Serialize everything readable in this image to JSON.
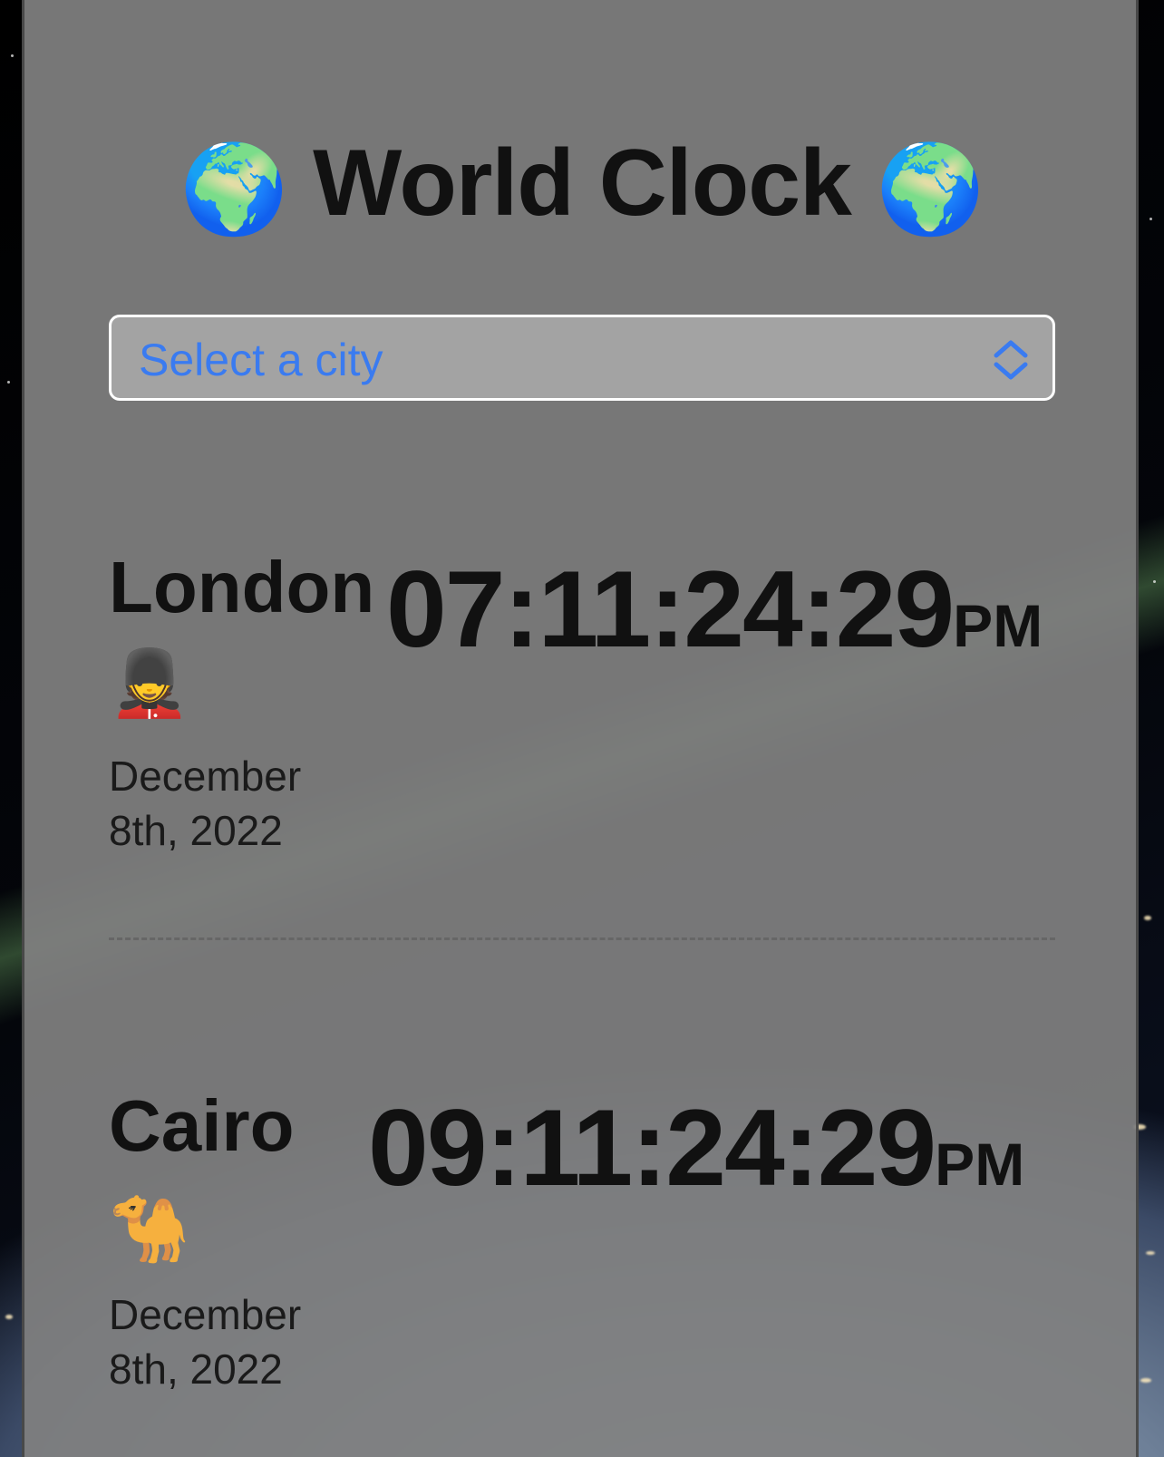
{
  "header": {
    "title": "World Clock",
    "globe_left": "🌍",
    "globe_right": "🌍"
  },
  "city_select": {
    "selected": "Select a city",
    "icon": "chevron-up-down-icon"
  },
  "cities": [
    {
      "name": "London",
      "emoji": "💂",
      "date": "December 8th, 2022",
      "time": "07:11:24:29",
      "period": "PM"
    },
    {
      "name": "Cairo",
      "emoji": "🐪",
      "date": "December 8th, 2022",
      "time": "09:11:24:29",
      "period": "PM"
    }
  ],
  "colors": {
    "select_text": "#3a7bf0",
    "panel": "#808080",
    "text": "#111111"
  }
}
